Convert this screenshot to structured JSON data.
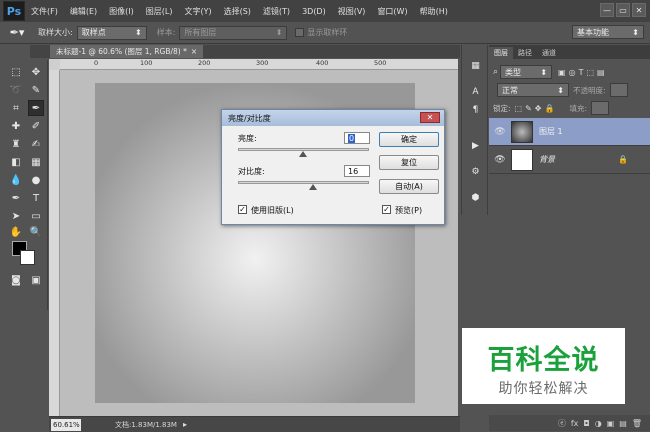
{
  "app": {
    "logo": "Ps"
  },
  "menu": [
    "文件(F)",
    "编辑(E)",
    "图像(I)",
    "图层(L)",
    "文字(Y)",
    "选择(S)",
    "滤镜(T)",
    "3D(D)",
    "视图(V)",
    "窗口(W)",
    "帮助(H)"
  ],
  "window_controls": {
    "minimize": "—",
    "restore": "▭",
    "close": "✕"
  },
  "options_bar": {
    "sample_size_label": "取样大小:",
    "sample_size_value": "取样点",
    "sample_label": "样本:",
    "sample_value": "所有图层",
    "show_ring_label": "显示取样环",
    "workspace": "基本功能"
  },
  "document": {
    "tab_title": "未标题-1 @ 60.6% (图层 1, RGB/8) *",
    "tab_close": "×",
    "ruler_ticks": [
      "0",
      "100",
      "200",
      "300",
      "400",
      "500"
    ],
    "zoom": "60.61%",
    "doc_info": "文档:1.83M/1.83M"
  },
  "layers_panel": {
    "tabs": [
      "图层",
      "路径",
      "通道"
    ],
    "filter_kind": "类型",
    "blend_mode": "正常",
    "opacity_label": "不透明度:",
    "lock_label": "锁定:",
    "fill_label": "填充:",
    "layers": [
      {
        "name": "图层 1",
        "selected": true
      },
      {
        "name": "背景",
        "selected": false,
        "locked": true
      }
    ],
    "footer_icons": [
      "ⓔ",
      "fx",
      "◘",
      "◑",
      "▣",
      "▤",
      "🗑"
    ]
  },
  "dialog": {
    "title": "亮度/对比度",
    "brightness_label": "亮度:",
    "brightness_value": "0",
    "contrast_label": "对比度:",
    "contrast_value": "16",
    "contrast_level": 0.16,
    "ok_label": "确定",
    "reset_label": "复位",
    "auto_label": "自动(A)",
    "use_legacy_label": "使用旧版(L)",
    "use_legacy_checked": true,
    "preview_label": "预览(P)",
    "preview_checked": true
  },
  "watermark": {
    "title": "百科全说",
    "subtitle": "助你轻松解决"
  },
  "colors": {
    "accent": "#8c9ec8",
    "watermark_green": "#1aa13b"
  }
}
